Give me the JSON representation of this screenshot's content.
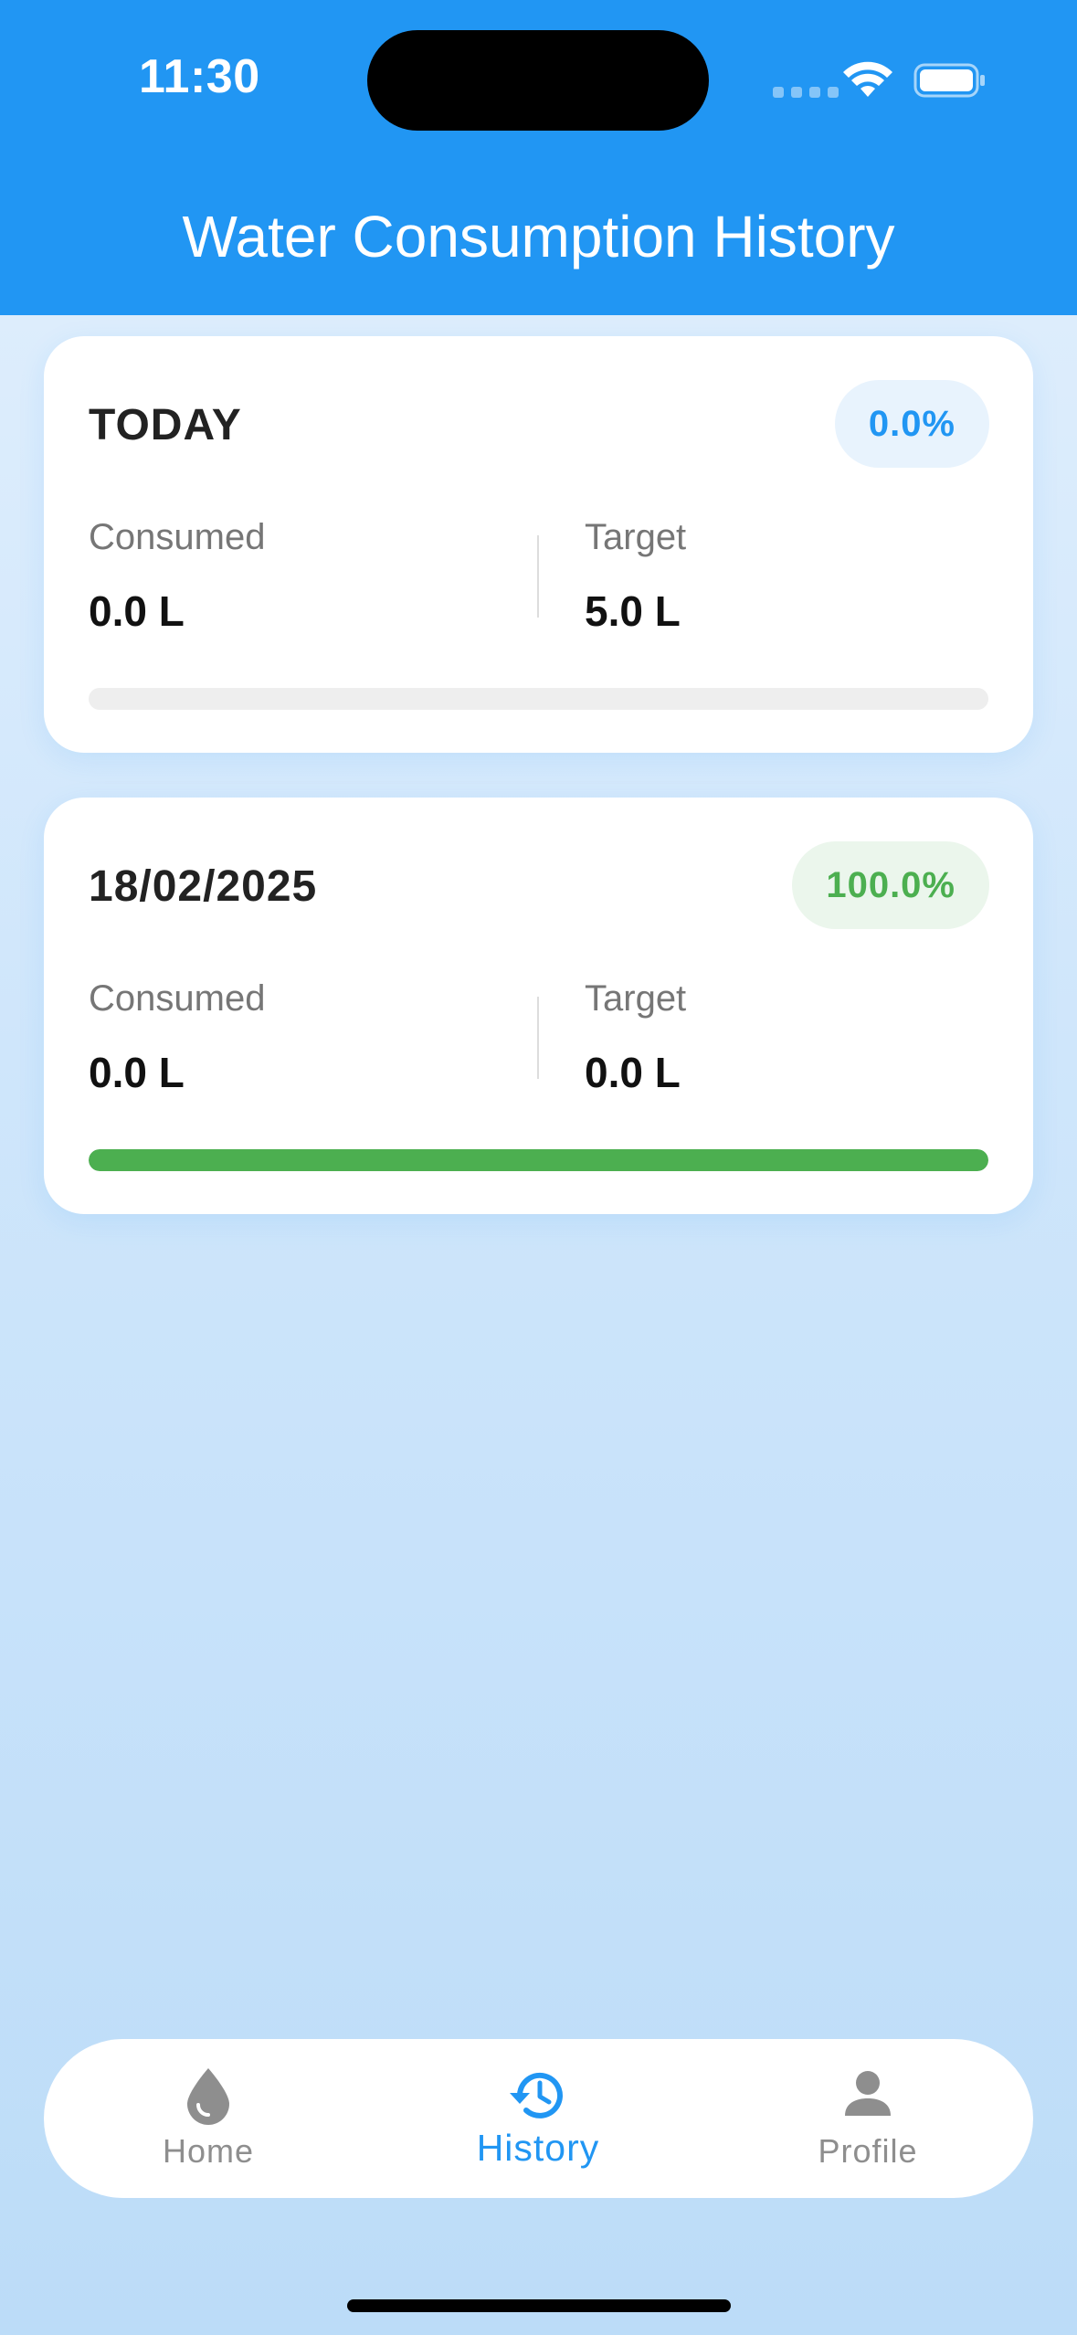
{
  "status_bar": {
    "time": "11:30"
  },
  "header": {
    "title": "Water Consumption History"
  },
  "cards": [
    {
      "title": "TODAY",
      "percent_text": "0.0%",
      "percent_value": 0.0,
      "consumed_label": "Consumed",
      "consumed_value": "0.0 L",
      "target_label": "Target",
      "target_value": "5.0 L",
      "badge_color": "#2196f3",
      "badge_bg": "#e8f3fd",
      "bar_color": "#2196f3"
    },
    {
      "title": "18/02/2025",
      "percent_text": "100.0%",
      "percent_value": 100.0,
      "consumed_label": "Consumed",
      "consumed_value": "0.0 L",
      "target_label": "Target",
      "target_value": "0.0 L",
      "badge_color": "#4caf50",
      "badge_bg": "#ebf6ec",
      "bar_color": "#4caf50"
    }
  ],
  "bottom_nav": {
    "items": [
      {
        "label": "Home",
        "icon": "water-drop-icon",
        "active": false
      },
      {
        "label": "History",
        "icon": "history-icon",
        "active": true
      },
      {
        "label": "Profile",
        "icon": "person-icon",
        "active": false
      }
    ],
    "active_color": "#2196f3",
    "inactive_color": "#8e8e8e"
  },
  "colors": {
    "primary": "#2196f3",
    "success": "#4caf50"
  }
}
